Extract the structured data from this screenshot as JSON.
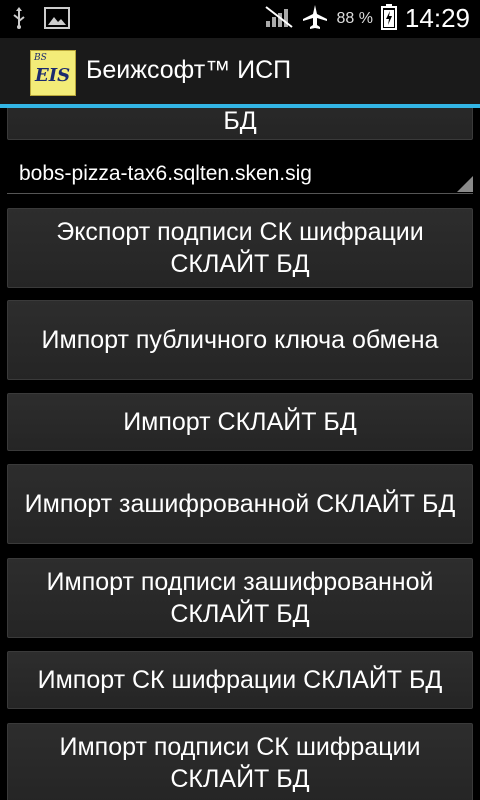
{
  "status_bar": {
    "battery_percent": "88 %",
    "time": "14:29",
    "icons": [
      "usb-icon",
      "image-icon",
      "no-signal-icon",
      "airplane-mode-icon",
      "battery-charging-icon"
    ]
  },
  "action_bar": {
    "logo_small": "BS",
    "logo_large": "EIS",
    "title": "Беижсофт™ ИСП"
  },
  "content": {
    "top_button_tail": "БД",
    "spinner_value": "bobs-pizza-tax6.sqlten.sken.sig",
    "buttons": [
      "Экспорт подписи СК шифрации СКЛАЙТ БД",
      "Импорт публичного ключа обмена",
      "Импорт СКЛАЙТ БД",
      "Импорт зашифрованной СКЛАЙТ БД",
      "Импорт подписи зашифрованной СКЛАЙТ БД",
      "Импорт СК шифрации СКЛАЙТ БД",
      "Импорт подписи СК шифрации СКЛАЙТ БД"
    ]
  },
  "colors": {
    "accent": "#33b5e5",
    "background": "#000000",
    "action_bar": "#1a1a1a",
    "button": "#2a2a2a"
  }
}
